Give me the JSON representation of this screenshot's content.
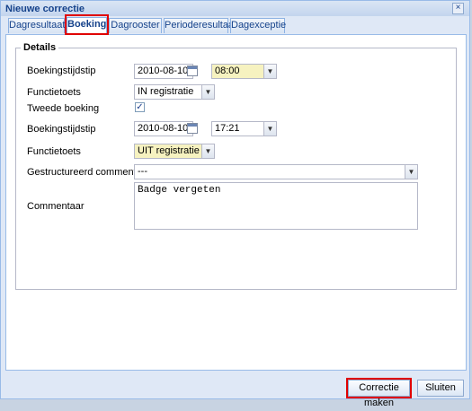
{
  "window": {
    "title": "Nieuwe correctie"
  },
  "tabs": [
    {
      "label": "Dagresultaat"
    },
    {
      "label": "Boeking"
    },
    {
      "label": "Dagrooster"
    },
    {
      "label": "Perioderesultaat"
    },
    {
      "label": "Dagexceptie"
    }
  ],
  "details": {
    "legend": "Details",
    "boekingstijdstip_label": "Boekingstijdstip",
    "boekingstijdstip_date": "2010-08-10",
    "boekingstijdstip_time": "08:00",
    "functietoets_label": "Functietoets",
    "functietoets_value": "IN registratie",
    "tweede_boeking_label": "Tweede boeking",
    "tweede_boeking_checked": true,
    "boekingstijdstip2_label": "Boekingstijdstip",
    "boekingstijdstip2_date": "2010-08-10",
    "boekingstijdstip2_time": "17:21",
    "functietoets2_label": "Functietoets",
    "functietoets2_value": "UIT registratie",
    "gestructureerd_label": "Gestructureerd commentaar",
    "gestructureerd_value": "---",
    "commentaar_label": "Commentaar",
    "commentaar_value": "Badge vergeten"
  },
  "buttons": {
    "correctie": "Correctie maken",
    "sluiten": "Sluiten"
  },
  "colors": {
    "highlight": "#e00000",
    "field_highlight": "#f6f2c0",
    "title_text": "#15428b"
  }
}
